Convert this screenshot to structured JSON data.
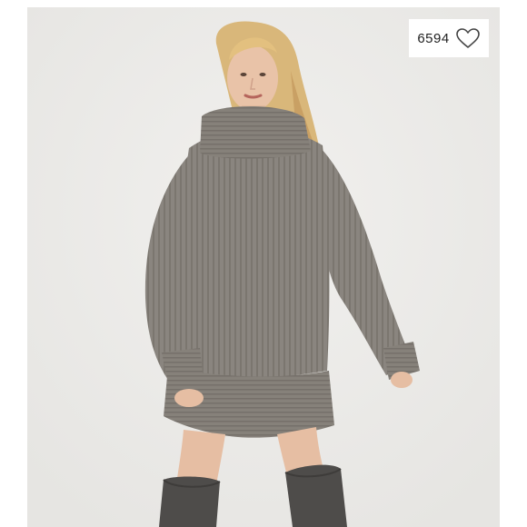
{
  "product_image": {
    "icon": "product-photo",
    "background_color": "#ececea",
    "sweater_color": "#8a857f",
    "boot_color": "#4e4c4a"
  },
  "like_badge": {
    "count": "6594",
    "icon": "heart-outline-icon"
  }
}
